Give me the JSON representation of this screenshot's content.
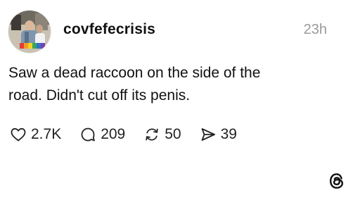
{
  "post": {
    "username": "covfefecrisis",
    "timestamp": "23h",
    "text_line1": "Saw a dead raccoon on the side of the",
    "text_line2": "road. Didn't cut off its penis."
  },
  "actions": {
    "likes": "2.7K",
    "replies": "209",
    "reposts": "50",
    "shares": "39"
  },
  "icons": {
    "like": "heart-icon",
    "reply": "speech-bubble-icon",
    "repost": "repost-arrows-icon",
    "share": "send-icon",
    "brand": "threads-logo-icon"
  },
  "colors": {
    "text": "#111111",
    "muted": "#9a9a9a",
    "background": "#ffffff"
  }
}
